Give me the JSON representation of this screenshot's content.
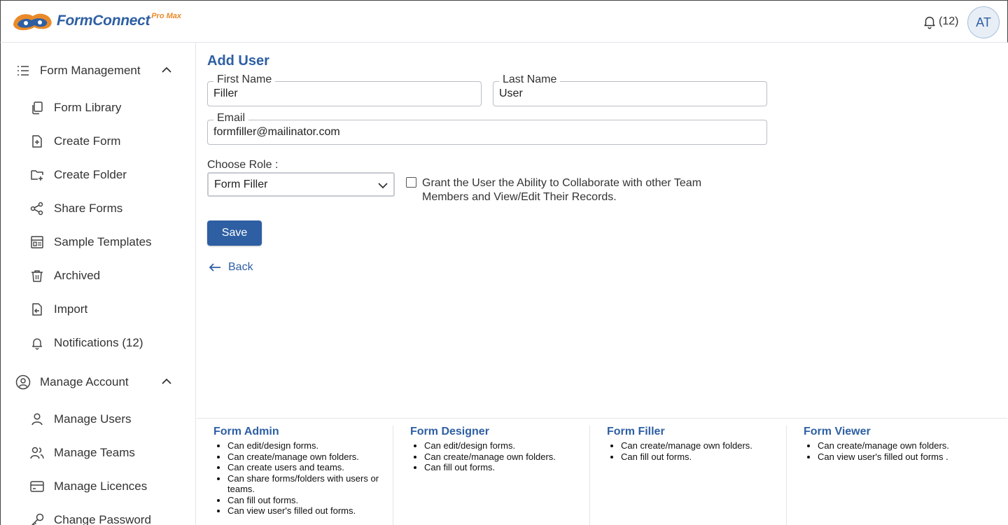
{
  "header": {
    "logo_text": "FormConnect",
    "logo_sup": "Pro Max",
    "notifications_label": "(12)",
    "avatar_initials": "AT"
  },
  "sidebar": {
    "sections": [
      {
        "label": "Form Management",
        "icon": "list-icon",
        "items": [
          {
            "label": "Form Library",
            "icon": "copy-icon"
          },
          {
            "label": "Create Form",
            "icon": "file-plus-icon"
          },
          {
            "label": "Create Folder",
            "icon": "folder-plus-icon"
          },
          {
            "label": "Share Forms",
            "icon": "share-icon"
          },
          {
            "label": "Sample Templates",
            "icon": "template-icon"
          },
          {
            "label": "Archived",
            "icon": "trash-icon"
          },
          {
            "label": "Import",
            "icon": "import-icon"
          },
          {
            "label": "Notifications (12)",
            "icon": "bell-icon"
          }
        ]
      },
      {
        "label": "Manage Account",
        "icon": "user-circle-icon",
        "items": [
          {
            "label": "Manage Users",
            "icon": "user-icon"
          },
          {
            "label": "Manage Teams",
            "icon": "users-icon"
          },
          {
            "label": "Manage Licences",
            "icon": "credit-card-icon"
          },
          {
            "label": "Change Password",
            "icon": "key-icon"
          }
        ]
      }
    ]
  },
  "form": {
    "title": "Add User",
    "first_name": {
      "label": "First Name",
      "value": "Filler"
    },
    "last_name": {
      "label": "Last Name",
      "value": "User"
    },
    "email": {
      "label": "Email",
      "value": "formfiller@mailinator.com"
    },
    "role_label": "Choose Role :",
    "role_value": "Form Filler",
    "grant_text": "Grant the User the Ability to Collaborate with other Team Members and View/Edit Their Records.",
    "grant_checked": false,
    "save_label": "Save",
    "back_label": "Back"
  },
  "roles": [
    {
      "title": "Form Admin",
      "items": [
        "Can edit/design forms.",
        "Can create/manage own folders.",
        "Can create users and teams.",
        "Can share forms/folders with users or teams.",
        "Can fill out forms.",
        "Can view user's filled out forms."
      ]
    },
    {
      "title": "Form Designer",
      "items": [
        "Can edit/design forms.",
        "Can create/manage own folders.",
        "Can fill out forms."
      ]
    },
    {
      "title": "Form Filler",
      "items": [
        "Can create/manage own folders.",
        "Can fill out forms."
      ]
    },
    {
      "title": "Form Viewer",
      "items": [
        "Can create/manage own folders.",
        "Can view user's filled out forms ."
      ]
    }
  ],
  "colors": {
    "accent": "#2e5fa3",
    "logo_orange": "#e98a2a"
  }
}
